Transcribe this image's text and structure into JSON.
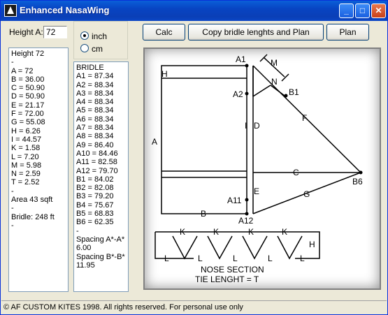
{
  "window": {
    "title": "Enhanced NasaWing"
  },
  "height_input": {
    "label": "Height A:",
    "value": "72"
  },
  "units": {
    "inch": "inch",
    "cm": "cm",
    "selected": "inch"
  },
  "buttons": {
    "calc": "Calc",
    "copy": "Copy bridle lenghts and Plan",
    "plan": "Plan"
  },
  "left_list": [
    "Height 72",
    "-",
    "A = 72",
    "B = 36.00",
    "C = 50.90",
    "D = 50.90",
    "E = 21.17",
    "F = 72.00",
    "G = 55.08",
    "H = 6.26",
    "I = 44.57",
    "K = 1.58",
    "L = 7.20",
    "M = 5.98",
    "N = 2.59",
    "T = 2.52",
    "-",
    "Area 43 sqft",
    "-",
    "Bridle: 248 ft",
    "-"
  ],
  "bridle_list": [
    "BRIDLE",
    "A1 = 87.34",
    "A2 = 88.34",
    "A3 = 88.34",
    "A4 = 88.34",
    "A5 = 88.34",
    "A6 = 88.34",
    "A7 = 88.34",
    "A8 = 88.34",
    "A9 = 86.40",
    "A10 = 84.46",
    "A11 = 82.58",
    "A12 = 79.70",
    "B1 = 84.02",
    "B2 = 82.08",
    "B3 = 79.20",
    "B4 = 75.67",
    "B5 = 68.83",
    "B6 = 62.35",
    "-",
    "Spacing A*-A*",
    "6.00",
    "Spacing B*-B*",
    "11.95"
  ],
  "diagram": {
    "labels": {
      "a1": "A1",
      "a2": "A2",
      "a11": "A11",
      "a12": "A12",
      "b1": "B1",
      "b6": "B6",
      "h": "H",
      "a": "A",
      "b": "B",
      "c": "C",
      "d": "D",
      "e": "E",
      "f": "F",
      "g": "G",
      "i": "I",
      "m": "M",
      "n": "N",
      "k": "K",
      "l": "L",
      "nose_h": "H"
    },
    "caption1": "NOSE SECTION",
    "caption2": "TIE LENGHT = T"
  },
  "status": "© AF CUSTOM KITES 1998. All rights reserved. For personal use only"
}
